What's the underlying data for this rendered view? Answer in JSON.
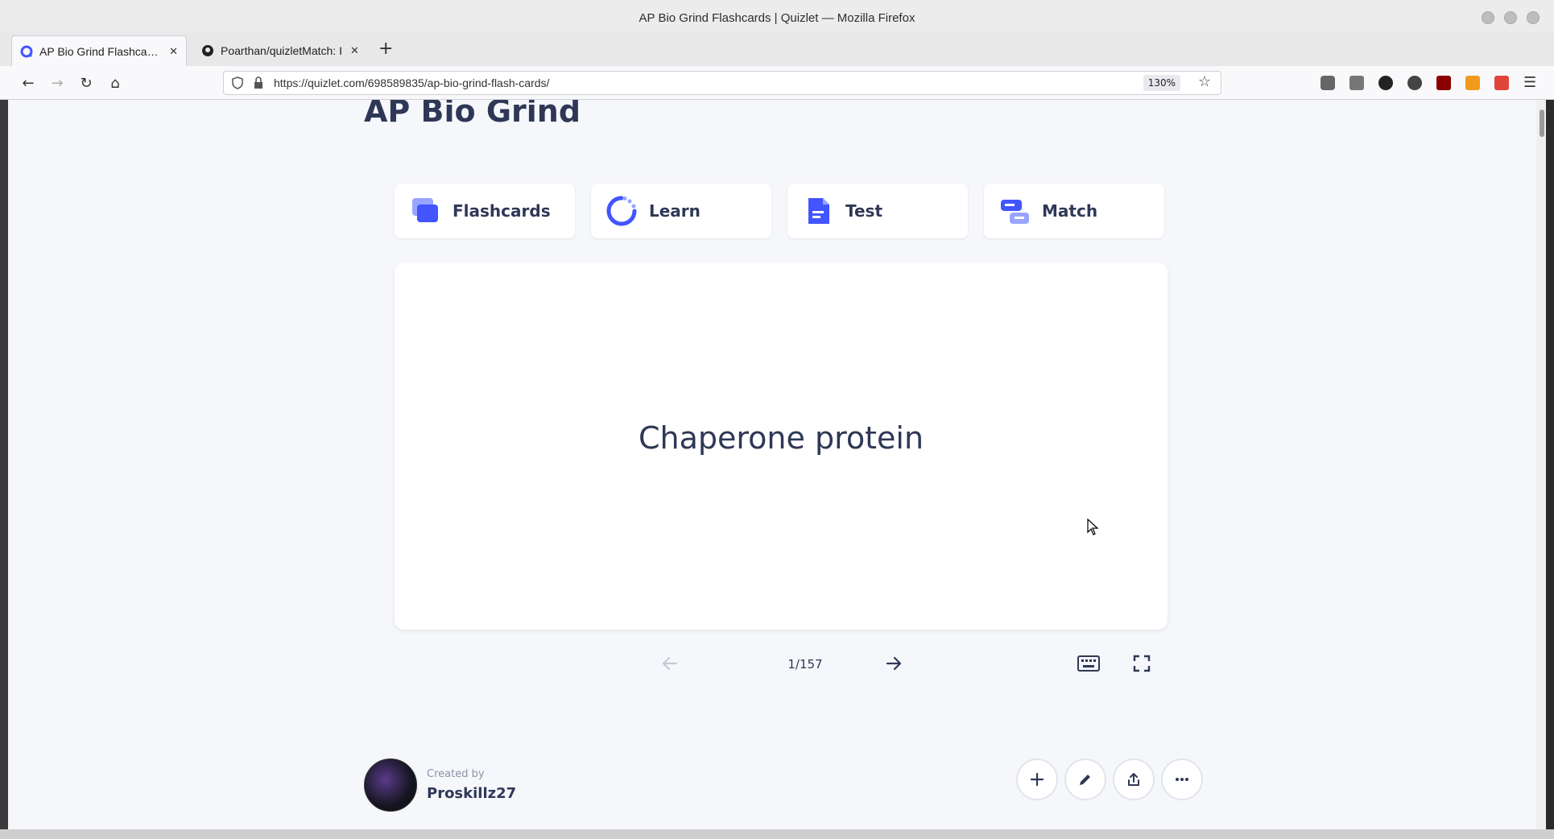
{
  "window": {
    "title": "AP Bio Grind Flashcards | Quizlet — Mozilla Firefox"
  },
  "tabs": [
    {
      "label": "AP Bio Grind Flashcards",
      "active": true
    },
    {
      "label": "Poarthan/quizletMatch: I",
      "active": false
    }
  ],
  "navbar": {
    "url": "https://quizlet.com/698589835/ap-bio-grind-flash-cards/",
    "zoom": "130%"
  },
  "page": {
    "set_title": "AP Bio Grind",
    "modes": [
      {
        "label": "Flashcards",
        "icon": "flashcards-icon"
      },
      {
        "label": "Learn",
        "icon": "learn-icon"
      },
      {
        "label": "Test",
        "icon": "test-icon"
      },
      {
        "label": "Match",
        "icon": "match-icon"
      }
    ],
    "card": {
      "term": "Chaperone protein"
    },
    "counter": "1/157",
    "creator": {
      "created_by_label": "Created by",
      "name": "Proskillz27"
    }
  },
  "colors": {
    "accent": "#4255ff",
    "text": "#2e3856",
    "page_bg": "#f6f7fb"
  }
}
